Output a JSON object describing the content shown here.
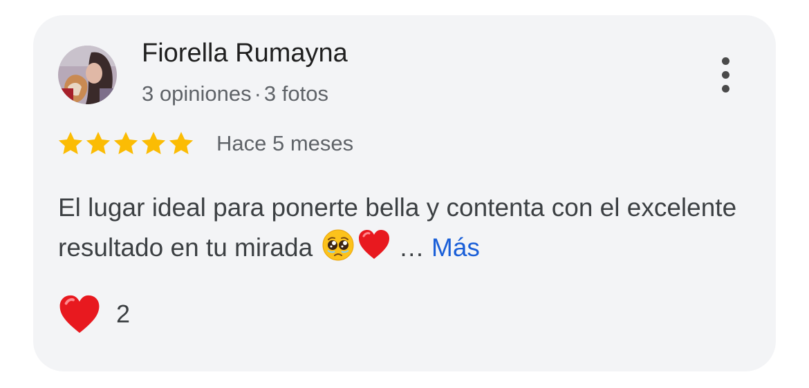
{
  "review": {
    "author_name": "Fiorella Rumayna",
    "author_reviews": "3 opiniones",
    "author_separator": "·",
    "author_photos": "3 fotos",
    "rating": 5,
    "rating_max": 5,
    "time_ago": "Hace 5 meses",
    "text": "El lugar ideal para ponerte bella y contenta con el excelente resultado en tu mirada",
    "text_emojis": [
      "pleading-face-icon",
      "red-heart-icon"
    ],
    "ellipsis": "…",
    "more_label": "Más",
    "reaction_icon": "red-heart-icon",
    "reaction_count": "2"
  },
  "colors": {
    "card_bg": "#f3f4f6",
    "star": "#fbbc04",
    "link": "#1a5fd8",
    "heart": "#e8191f"
  },
  "icons": {
    "menu": "more-vert-icon",
    "avatar": "profile-photo"
  }
}
